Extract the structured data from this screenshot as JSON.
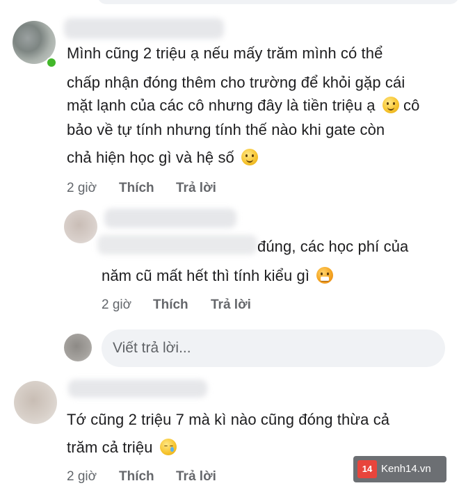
{
  "comments": [
    {
      "lines": [
        "Mình cũng 2 triệu ạ nếu mấy trăm mình có thể",
        "chấp nhận đóng thêm cho trường để khỏi gặp cái",
        "mặt lạnh của các cô nhưng đây là tiền triệu ạ",
        "cô",
        "bảo về tự tính nhưng tính thế nào khi gate còn",
        "chả hiện học gì và hệ số"
      ],
      "time": "2 giờ",
      "like": "Thích",
      "reply": "Trả lời"
    },
    {
      "lines": [
        "đúng, các học phí của",
        "năm cũ mất hết thì tính kiểu gì"
      ],
      "time": "2 giờ",
      "like": "Thích",
      "reply": "Trả lời"
    },
    {
      "lines": [
        "Tớ cũng 2 triệu 7 mà kì nào cũng đóng thừa cả",
        "trăm cả triệu"
      ],
      "time": "2 giờ",
      "like": "Thích",
      "reply": "Trả lời"
    }
  ],
  "reply_input": {
    "placeholder": "Viết trả lời..."
  },
  "emoji_icons": [
    "slightly-smiling-face",
    "slightly-smiling-face",
    "steam-from-nose-face",
    "sleepy-face"
  ],
  "watermark": {
    "badge": "14",
    "text": "Kenh14.vn"
  },
  "colors": {
    "text": "#1d1d1f",
    "meta": "#65676b",
    "input_bg": "#f0f2f5",
    "online": "#42b72a"
  }
}
